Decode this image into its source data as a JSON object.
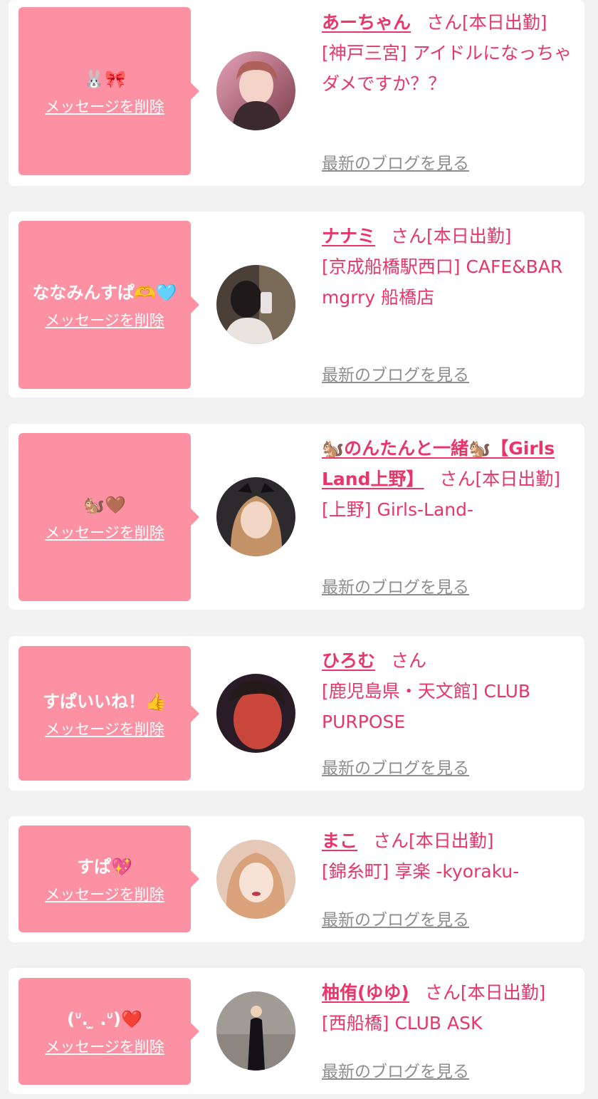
{
  "delete_label": "メッセージを削除",
  "blog_label": "最新のブログを見る",
  "san_label": "さん",
  "colors": {
    "accent": "#e8356a",
    "bubble": "#fc91a3",
    "muted": "#8e8e8e",
    "page_bg": "#f1f1f1"
  },
  "cards": [
    {
      "message": "🐰🎀",
      "name": "あーちゃん",
      "suffix": "さん[本日出勤]",
      "location": "[神戸三宮] アイドルになっちゃダメですか？？",
      "avatar_icon": "avatar-photo"
    },
    {
      "message": "ななみんすぱ🫶🩵",
      "name": "ナナミ",
      "suffix": "さん[本日出勤]",
      "location": "[京成船橋駅西口] CAFE&BAR mgrry 船橋店",
      "avatar_icon": "avatar-photo"
    },
    {
      "message": "🐿️🤎",
      "name": "🐿️のんたんと一緒🐿️【Girls Land上野】",
      "suffix": "さん[本日出勤]",
      "location": "[上野] Girls-Land-",
      "avatar_icon": "avatar-photo"
    },
    {
      "message": "すぱいいね！👍",
      "name": "ひろむ",
      "suffix": "さん",
      "location": "[鹿児島県・天文館] CLUB PURPOSE",
      "avatar_icon": "avatar-photo"
    },
    {
      "message": "すぱ💖",
      "name": "まこ",
      "suffix": "さん[本日出勤]",
      "location": "[錦糸町] 享楽 -kyoraku-",
      "avatar_icon": "avatar-photo"
    },
    {
      "message": "(ᐡ.  ̫ .ᐡ)❤️",
      "name": "柚侑(ゆゆ)",
      "suffix": "さん[本日出勤]",
      "location": "[西船橋] CLUB ASK",
      "avatar_icon": "avatar-photo"
    }
  ]
}
